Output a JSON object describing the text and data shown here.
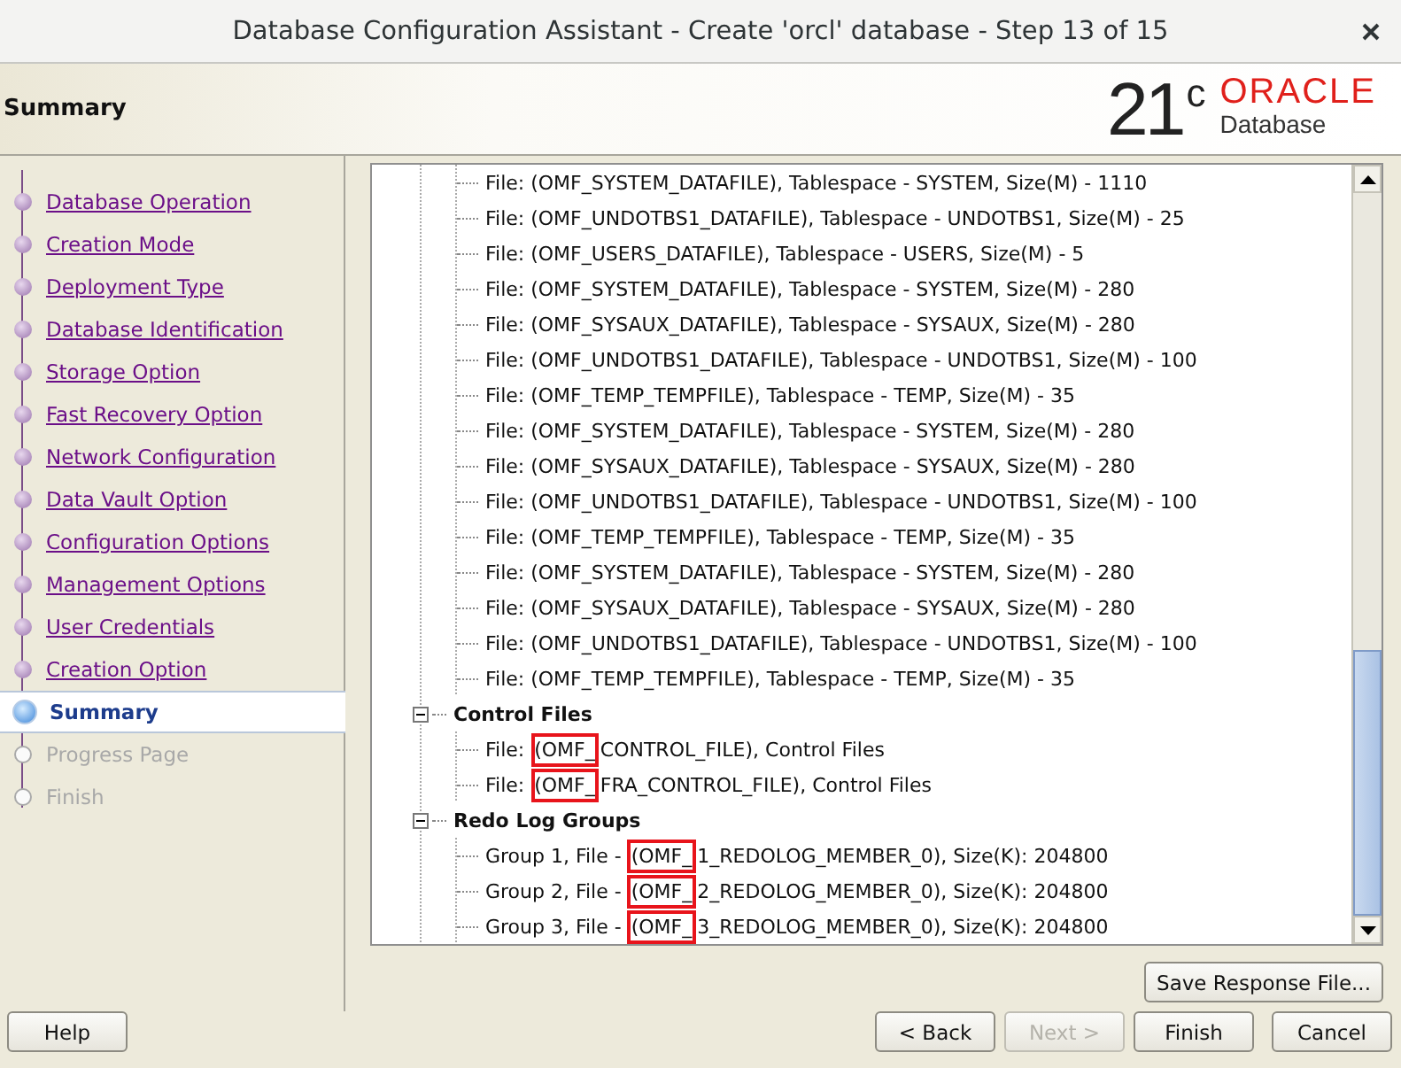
{
  "window": {
    "title": "Database Configuration Assistant - Create 'orcl' database - Step 13 of 15"
  },
  "header": {
    "title": "Summary",
    "logo": {
      "version": "21",
      "superscript": "c",
      "brand": "ORACLE",
      "product": "Database"
    }
  },
  "steps": [
    {
      "label": "Database Operation",
      "selected": false,
      "disabled": false
    },
    {
      "label": "Creation Mode",
      "selected": false,
      "disabled": false
    },
    {
      "label": "Deployment Type",
      "selected": false,
      "disabled": false
    },
    {
      "label": "Database Identification",
      "selected": false,
      "disabled": false
    },
    {
      "label": "Storage Option",
      "selected": false,
      "disabled": false
    },
    {
      "label": "Fast Recovery Option",
      "selected": false,
      "disabled": false
    },
    {
      "label": "Network Configuration",
      "selected": false,
      "disabled": false
    },
    {
      "label": "Data Vault Option",
      "selected": false,
      "disabled": false
    },
    {
      "label": "Configuration Options",
      "selected": false,
      "disabled": false
    },
    {
      "label": "Management Options",
      "selected": false,
      "disabled": false
    },
    {
      "label": "User Credentials",
      "selected": false,
      "disabled": false
    },
    {
      "label": "Creation Option",
      "selected": false,
      "disabled": false
    },
    {
      "label": "Summary",
      "selected": true,
      "disabled": false
    },
    {
      "label": "Progress Page",
      "selected": false,
      "disabled": true
    },
    {
      "label": "Finish",
      "selected": false,
      "disabled": true
    }
  ],
  "tree": {
    "files": [
      "File: (OMF_SYSTEM_DATAFILE), Tablespace - SYSTEM, Size(M) - 1110",
      "File: (OMF_UNDOTBS1_DATAFILE), Tablespace - UNDOTBS1, Size(M) - 25",
      "File: (OMF_USERS_DATAFILE), Tablespace - USERS, Size(M) - 5",
      "File: (OMF_SYSTEM_DATAFILE), Tablespace - SYSTEM, Size(M) - 280",
      "File: (OMF_SYSAUX_DATAFILE), Tablespace - SYSAUX, Size(M) - 280",
      "File: (OMF_UNDOTBS1_DATAFILE), Tablespace - UNDOTBS1, Size(M) - 100",
      "File: (OMF_TEMP_TEMPFILE), Tablespace - TEMP, Size(M) - 35",
      "File: (OMF_SYSTEM_DATAFILE), Tablespace - SYSTEM, Size(M) - 280",
      "File: (OMF_SYSAUX_DATAFILE), Tablespace - SYSAUX, Size(M) - 280",
      "File: (OMF_UNDOTBS1_DATAFILE), Tablespace - UNDOTBS1, Size(M) - 100",
      "File: (OMF_TEMP_TEMPFILE), Tablespace - TEMP, Size(M) - 35",
      "File: (OMF_SYSTEM_DATAFILE), Tablespace - SYSTEM, Size(M) - 280",
      "File: (OMF_SYSAUX_DATAFILE), Tablespace - SYSAUX, Size(M) - 280",
      "File: (OMF_UNDOTBS1_DATAFILE), Tablespace - UNDOTBS1, Size(M) - 100",
      "File: (OMF_TEMP_TEMPFILE), Tablespace - TEMP, Size(M) - 35"
    ],
    "groups": [
      {
        "label": "Control Files",
        "expanded": true,
        "children": [
          {
            "before": "File: ",
            "marked": "(OMF_",
            "after": "CONTROL_FILE), Control Files"
          },
          {
            "before": "File: ",
            "marked": "(OMF_",
            "after": "FRA_CONTROL_FILE), Control Files"
          }
        ]
      },
      {
        "label": "Redo Log Groups",
        "expanded": true,
        "children": [
          {
            "before": "Group 1, File - ",
            "marked": "(OMF_",
            "after": "1_REDOLOG_MEMBER_0), Size(K): 204800"
          },
          {
            "before": "Group 2, File - ",
            "marked": "(OMF_",
            "after": "2_REDOLOG_MEMBER_0), Size(K): 204800"
          },
          {
            "before": "Group 3, File - ",
            "marked": "(OMF_",
            "after": "3_REDOLOG_MEMBER_0), Size(K): 204800"
          }
        ]
      }
    ]
  },
  "save_button": {
    "label": "Save Response File...",
    "disabled": false
  },
  "buttons": [
    {
      "label": "Help",
      "disabled": false,
      "kind": "left"
    },
    {
      "label": "< Back",
      "disabled": false,
      "kind": "right"
    },
    {
      "label": "Next >",
      "disabled": true,
      "kind": "right"
    },
    {
      "label": "Finish",
      "disabled": false,
      "kind": "right"
    },
    {
      "label": "Cancel",
      "disabled": false,
      "kind": "right"
    }
  ]
}
